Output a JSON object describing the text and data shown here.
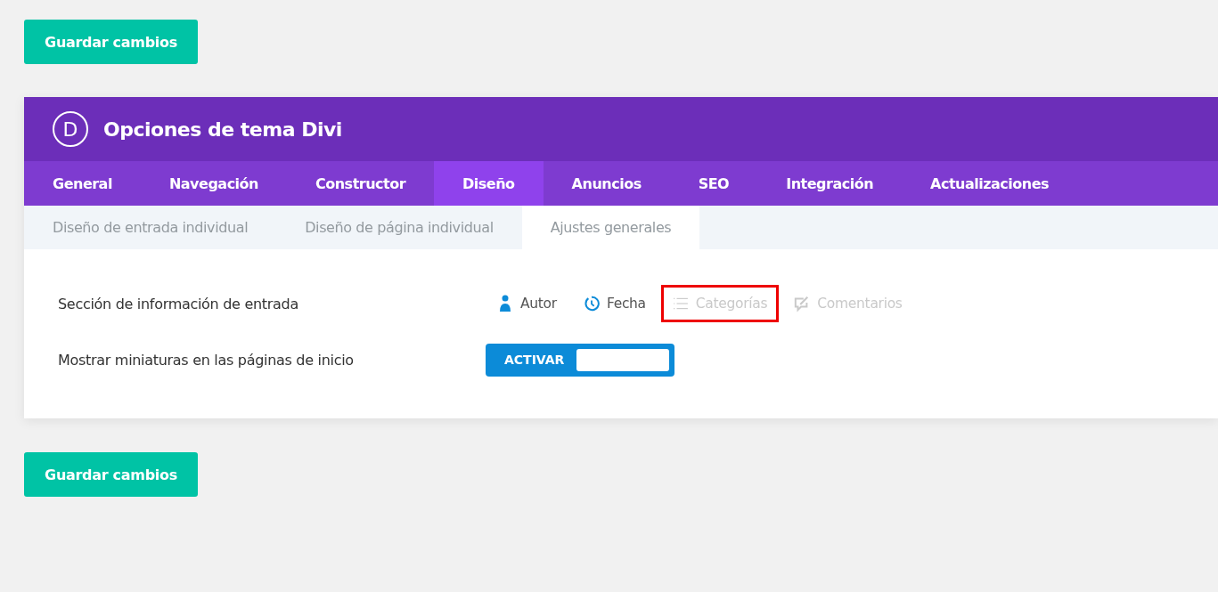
{
  "top_button": "Guardar cambios",
  "panel": {
    "logo": "D",
    "title": "Opciones de tema Divi",
    "tabs": [
      {
        "label": "General",
        "selected": false
      },
      {
        "label": "Navegación",
        "selected": false
      },
      {
        "label": "Constructor",
        "selected": false
      },
      {
        "label": "Diseño",
        "selected": true
      },
      {
        "label": "Anuncios",
        "selected": false
      },
      {
        "label": "SEO",
        "selected": false
      },
      {
        "label": "Integración",
        "selected": false
      },
      {
        "label": "Actualizaciones",
        "selected": false
      }
    ],
    "subtabs": [
      {
        "label": "Diseño de entrada individual",
        "selected": false
      },
      {
        "label": "Diseño de página individual",
        "selected": false
      },
      {
        "label": "Ajustes generales",
        "selected": true
      }
    ],
    "settings": [
      {
        "kind": "meta",
        "label": "Sección de información de entrada",
        "options": [
          {
            "kind": "author",
            "label": "Autor",
            "on": true,
            "highlighted": false
          },
          {
            "kind": "date",
            "label": "Fecha",
            "on": true,
            "highlighted": false
          },
          {
            "kind": "categories",
            "label": "Categorías",
            "on": false,
            "highlighted": true
          },
          {
            "kind": "comments",
            "label": "Comentarios",
            "on": false,
            "highlighted": false
          }
        ]
      },
      {
        "kind": "toggle",
        "label": "Mostrar miniaturas en las páginas de inicio",
        "toggle_label": "ACTIVAR",
        "on": true
      }
    ]
  },
  "bottom_button": "Guardar cambios"
}
